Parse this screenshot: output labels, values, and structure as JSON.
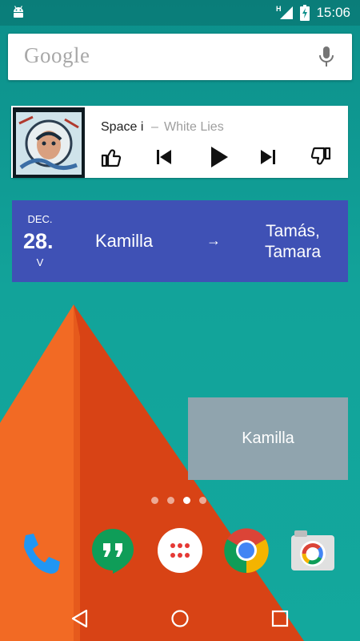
{
  "status_bar": {
    "network_type": "H",
    "time": "15:06"
  },
  "search": {
    "logo_text": "Google",
    "mic": "mic-icon"
  },
  "music": {
    "title": "Space i",
    "separator": "–",
    "artist": "White Lies",
    "controls": [
      "thumbs-up-icon",
      "previous-icon",
      "play-icon",
      "next-icon",
      "thumbs-down-icon"
    ]
  },
  "nameday": {
    "month": "DEC.",
    "day": "28.",
    "weekday": "V",
    "name_today": "Kamilla",
    "arrow": "→",
    "name_tomorrow_line1": "Tamás,",
    "name_tomorrow_line2": "Tamara"
  },
  "name_widget": {
    "text": "Kamilla"
  },
  "page_indicator": {
    "count": 4,
    "active_index": 2
  },
  "dock": [
    "phone-icon",
    "hangouts-icon",
    "app-drawer-icon",
    "chrome-icon",
    "camera-icon"
  ],
  "navigation": [
    "back-icon",
    "home-icon",
    "recents-icon"
  ],
  "colors": {
    "wallpaper_teal": "#12a39a",
    "pyramid_orange": "#f4511e",
    "nameday_blue": "#3f51b5",
    "name_widget_gray": "#90a4ae"
  }
}
